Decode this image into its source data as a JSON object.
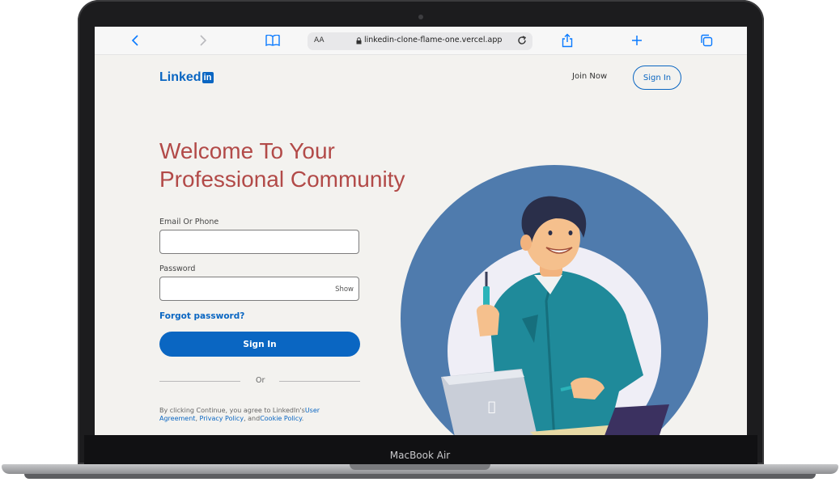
{
  "device": {
    "name": "MacBook Air"
  },
  "browser": {
    "reader_label": "AA",
    "url": "linkedin-clone-flame-one.vercel.app"
  },
  "header": {
    "logo_text": "Linked",
    "logo_badge": "in",
    "join_label": "Join Now",
    "signin_label": "Sign In"
  },
  "hero": {
    "headline_line1": "Welcome To Your",
    "headline_line2": "Professional Community"
  },
  "form": {
    "email_label": "Email Or Phone",
    "email_value": "",
    "password_label": "Password",
    "password_value": "",
    "show_label": "Show",
    "forgot_label": "Forgot password?",
    "signin_label": "Sign In",
    "or_label": "Or"
  },
  "legal": {
    "prefix": "By clicking Continue, you agree to LinkedIn's",
    "user_agreement": "User Agreement",
    "sep": ", ",
    "privacy": "Privacy Policy",
    "and": ", and",
    "cookie": "Cookie Policy",
    "suffix": "."
  },
  "colors": {
    "brand": "#0a66c2",
    "headline": "#b24a48",
    "page_bg": "#f3f2ef",
    "hero_circle": "#4f7bad"
  },
  "icons": [
    "chevron-left-icon",
    "chevron-right-icon",
    "book-icon",
    "lock-icon",
    "reload-icon",
    "share-icon",
    "plus-icon",
    "tabs-icon"
  ]
}
